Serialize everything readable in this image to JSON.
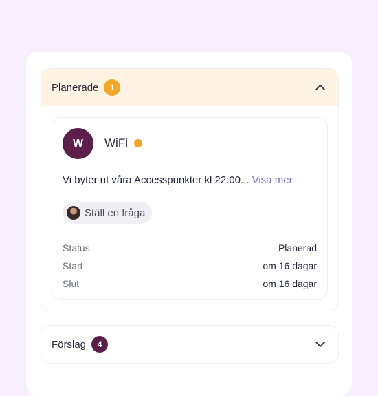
{
  "sections": {
    "planned": {
      "title": "Planerade",
      "count": "1",
      "badge_color": "#f5a623",
      "expanded": true
    },
    "suggestions": {
      "title": "Förslag",
      "count": "4",
      "badge_color": "#5b1f4a",
      "expanded": false
    }
  },
  "card": {
    "avatar_letter": "W",
    "title": "WiFi",
    "status_dot_color": "#f5a623",
    "description": "Vi byter ut våra Accesspunkter kl 22:00...",
    "read_more": "Visa mer",
    "ask_button": "Ställ en fråga",
    "rows": [
      {
        "key": "Status",
        "value": "Planerad"
      },
      {
        "key": "Start",
        "value": "om 16 dagar"
      },
      {
        "key": "Slut",
        "value": "om 16 dagar"
      }
    ]
  },
  "icons": {
    "expanded_chevron": "chevron-up-icon",
    "collapsed_chevron": "chevron-down-icon"
  }
}
